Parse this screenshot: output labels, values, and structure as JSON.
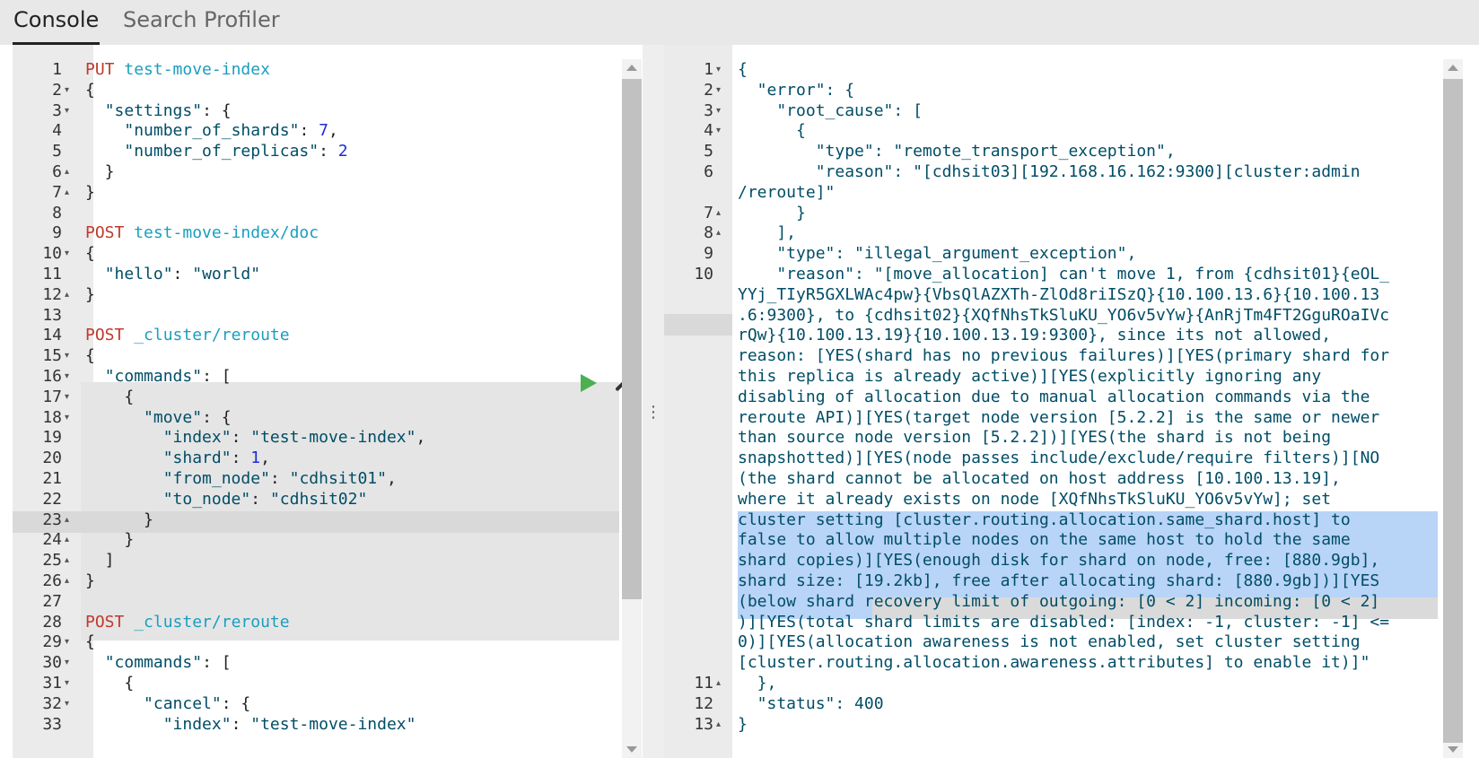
{
  "tabs": [
    {
      "label": "Console",
      "active": true
    },
    {
      "label": "Search Profiler",
      "active": false
    }
  ],
  "request_editor": {
    "lines": [
      {
        "n": "1",
        "fold": "",
        "parts": [
          [
            "method",
            "PUT"
          ],
          [
            "punct",
            " "
          ],
          [
            "url",
            "test-move-index"
          ]
        ]
      },
      {
        "n": "2",
        "fold": "▾",
        "parts": [
          [
            "punct",
            "{"
          ]
        ]
      },
      {
        "n": "3",
        "fold": "▾",
        "parts": [
          [
            "punct",
            "  "
          ],
          [
            "key",
            "\"settings\""
          ],
          [
            "punct",
            ": {"
          ]
        ]
      },
      {
        "n": "4",
        "fold": "",
        "parts": [
          [
            "punct",
            "    "
          ],
          [
            "key",
            "\"number_of_shards\""
          ],
          [
            "punct",
            ": "
          ],
          [
            "num",
            "7"
          ],
          [
            "punct",
            ","
          ]
        ]
      },
      {
        "n": "5",
        "fold": "",
        "parts": [
          [
            "punct",
            "    "
          ],
          [
            "key",
            "\"number_of_replicas\""
          ],
          [
            "punct",
            ": "
          ],
          [
            "num",
            "2"
          ]
        ]
      },
      {
        "n": "6",
        "fold": "▴",
        "parts": [
          [
            "punct",
            "  }"
          ]
        ]
      },
      {
        "n": "7",
        "fold": "▴",
        "parts": [
          [
            "punct",
            "}"
          ]
        ]
      },
      {
        "n": "8",
        "fold": "",
        "parts": []
      },
      {
        "n": "9",
        "fold": "",
        "parts": [
          [
            "method",
            "POST"
          ],
          [
            "punct",
            " "
          ],
          [
            "url",
            "test-move-index/doc"
          ]
        ]
      },
      {
        "n": "10",
        "fold": "▾",
        "parts": [
          [
            "punct",
            "{"
          ]
        ]
      },
      {
        "n": "11",
        "fold": "",
        "parts": [
          [
            "punct",
            "  "
          ],
          [
            "key",
            "\"hello\""
          ],
          [
            "punct",
            ": "
          ],
          [
            "str",
            "\"world\""
          ]
        ]
      },
      {
        "n": "12",
        "fold": "▴",
        "parts": [
          [
            "punct",
            "}"
          ]
        ]
      },
      {
        "n": "13",
        "fold": "",
        "parts": []
      },
      {
        "n": "14",
        "fold": "",
        "parts": [
          [
            "method",
            "POST"
          ],
          [
            "punct",
            " "
          ],
          [
            "url",
            "_cluster/reroute"
          ]
        ]
      },
      {
        "n": "15",
        "fold": "▾",
        "parts": [
          [
            "punct",
            "{"
          ]
        ]
      },
      {
        "n": "16",
        "fold": "▾",
        "parts": [
          [
            "punct",
            "  "
          ],
          [
            "key",
            "\"commands\""
          ],
          [
            "punct",
            ": ["
          ]
        ]
      },
      {
        "n": "17",
        "fold": "▾",
        "parts": [
          [
            "punct",
            "    {"
          ]
        ]
      },
      {
        "n": "18",
        "fold": "▾",
        "parts": [
          [
            "punct",
            "      "
          ],
          [
            "key",
            "\"move\""
          ],
          [
            "punct",
            ": {"
          ]
        ]
      },
      {
        "n": "19",
        "fold": "",
        "parts": [
          [
            "punct",
            "        "
          ],
          [
            "key",
            "\"index\""
          ],
          [
            "punct",
            ": "
          ],
          [
            "str",
            "\"test-move-index\""
          ],
          [
            "punct",
            ","
          ]
        ]
      },
      {
        "n": "20",
        "fold": "",
        "parts": [
          [
            "punct",
            "        "
          ],
          [
            "key",
            "\"shard\""
          ],
          [
            "punct",
            ": "
          ],
          [
            "num",
            "1"
          ],
          [
            "punct",
            ","
          ]
        ]
      },
      {
        "n": "21",
        "fold": "",
        "parts": [
          [
            "punct",
            "        "
          ],
          [
            "key",
            "\"from_node\""
          ],
          [
            "punct",
            ": "
          ],
          [
            "str",
            "\"cdhsit01\""
          ],
          [
            "punct",
            ","
          ]
        ]
      },
      {
        "n": "22",
        "fold": "",
        "parts": [
          [
            "punct",
            "        "
          ],
          [
            "key",
            "\"to_node\""
          ],
          [
            "punct",
            ": "
          ],
          [
            "str",
            "\"cdhsit02\""
          ]
        ]
      },
      {
        "n": "23",
        "fold": "▴",
        "parts": [
          [
            "punct",
            "      }"
          ]
        ]
      },
      {
        "n": "24",
        "fold": "▴",
        "parts": [
          [
            "punct",
            "    }"
          ]
        ]
      },
      {
        "n": "25",
        "fold": "▴",
        "parts": [
          [
            "punct",
            "  ]"
          ]
        ]
      },
      {
        "n": "26",
        "fold": "▴",
        "parts": [
          [
            "punct",
            "}"
          ]
        ]
      },
      {
        "n": "27",
        "fold": "",
        "parts": []
      },
      {
        "n": "28",
        "fold": "",
        "parts": [
          [
            "method",
            "POST"
          ],
          [
            "punct",
            " "
          ],
          [
            "url",
            "_cluster/reroute"
          ]
        ]
      },
      {
        "n": "29",
        "fold": "▾",
        "parts": [
          [
            "punct",
            "{"
          ]
        ]
      },
      {
        "n": "30",
        "fold": "▾",
        "parts": [
          [
            "punct",
            "  "
          ],
          [
            "key",
            "\"commands\""
          ],
          [
            "punct",
            ": ["
          ]
        ]
      },
      {
        "n": "31",
        "fold": "▾",
        "parts": [
          [
            "punct",
            "    {"
          ]
        ]
      },
      {
        "n": "32",
        "fold": "▾",
        "parts": [
          [
            "punct",
            "      "
          ],
          [
            "key",
            "\"cancel\""
          ],
          [
            "punct",
            ": {"
          ]
        ]
      },
      {
        "n": "33",
        "fold": "",
        "parts": [
          [
            "punct",
            "        "
          ],
          [
            "key",
            "\"index\""
          ],
          [
            "punct",
            ": "
          ],
          [
            "str",
            "\"test-move-index\""
          ]
        ]
      }
    ]
  },
  "response_viewer": {
    "lines": [
      {
        "n": "1",
        "fold": "▾",
        "text": "{"
      },
      {
        "n": "2",
        "fold": "▾",
        "text": "  \"error\": {"
      },
      {
        "n": "3",
        "fold": "▾",
        "text": "    \"root_cause\": ["
      },
      {
        "n": "4",
        "fold": "▾",
        "text": "      {"
      },
      {
        "n": "5",
        "fold": "",
        "text": "        \"type\": \"remote_transport_exception\","
      },
      {
        "n": "6",
        "fold": "",
        "text": "        \"reason\": \"[cdhsit03][192.168.16.162:9300][cluster:admin"
      },
      {
        "n": "",
        "fold": "",
        "text": "/reroute]\""
      },
      {
        "n": "7",
        "fold": "▴",
        "text": "      }"
      },
      {
        "n": "8",
        "fold": "▴",
        "text": "    ],"
      },
      {
        "n": "9",
        "fold": "",
        "text": "    \"type\": \"illegal_argument_exception\","
      },
      {
        "n": "10",
        "fold": "",
        "text": "    \"reason\": \"[move_allocation] can't move 1, from {cdhsit01}{eOL_"
      },
      {
        "n": "",
        "fold": "",
        "text": "YYj_TIyR5GXLWAc4pw}{VbsQlAZXTh-ZlOd8riISzQ}{10.100.13.6}{10.100.13"
      },
      {
        "n": "",
        "fold": "",
        "text": ".6:9300}, to {cdhsit02}{XQfNhsTkSluKU_YO6v5vYw}{AnRjTm4FT2GguROaIVc"
      },
      {
        "n": "",
        "fold": "",
        "text": "rQw}{10.100.13.19}{10.100.13.19:9300}, since its not allowed,"
      },
      {
        "n": "",
        "fold": "",
        "text": "reason: [YES(shard has no previous failures)][YES(primary shard for"
      },
      {
        "n": "",
        "fold": "",
        "text": "this replica is already active)][YES(explicitly ignoring any"
      },
      {
        "n": "",
        "fold": "",
        "text": "disabling of allocation due to manual allocation commands via the"
      },
      {
        "n": "",
        "fold": "",
        "text": "reroute API)][YES(target node version [5.2.2] is the same or newer"
      },
      {
        "n": "",
        "fold": "",
        "text": "than source node version [5.2.2])][YES(the shard is not being"
      },
      {
        "n": "",
        "fold": "",
        "text": "snapshotted)][YES(node passes include/exclude/require filters)][NO"
      },
      {
        "n": "",
        "fold": "",
        "text": "(the shard cannot be allocated on host address [10.100.13.19],"
      },
      {
        "n": "",
        "fold": "",
        "text": "where it already exists on node [XQfNhsTkSluKU_YO6v5vYw]; set"
      },
      {
        "n": "",
        "fold": "",
        "text": "cluster setting [cluster.routing.allocation.same_shard.host] to"
      },
      {
        "n": "",
        "fold": "",
        "text": "false to allow multiple nodes on the same host to hold the same"
      },
      {
        "n": "",
        "fold": "",
        "text": "shard copies)][YES(enough disk for shard on node, free: [880.9gb],"
      },
      {
        "n": "",
        "fold": "",
        "text": "shard size: [19.2kb], free after allocating shard: [880.9gb])][YES"
      },
      {
        "n": "",
        "fold": "",
        "text": "(below shard recovery limit of outgoing: [0 < 2] incoming: [0 < 2]"
      },
      {
        "n": "",
        "fold": "",
        "text": ")][YES(total shard limits are disabled: [index: -1, cluster: -1] <="
      },
      {
        "n": "",
        "fold": "",
        "text": "0)][YES(allocation awareness is not enabled, set cluster setting"
      },
      {
        "n": "",
        "fold": "",
        "text": "[cluster.routing.allocation.awareness.attributes] to enable it)]\""
      },
      {
        "n": "11",
        "fold": "▴",
        "text": "  },"
      },
      {
        "n": "12",
        "fold": "",
        "text": "  \"status\": 400"
      },
      {
        "n": "13",
        "fold": "▴",
        "text": "}"
      }
    ]
  },
  "icons": {
    "run": "play-icon",
    "settings": "wrench-icon",
    "divider": "vertical-ellipsis-icon"
  },
  "colors": {
    "method": "#c0392b",
    "url": "#1a9ebf",
    "string": "#004d66",
    "number": "#1f2bd6",
    "selection": "#b8d4f7",
    "run_button": "#4caf50"
  }
}
